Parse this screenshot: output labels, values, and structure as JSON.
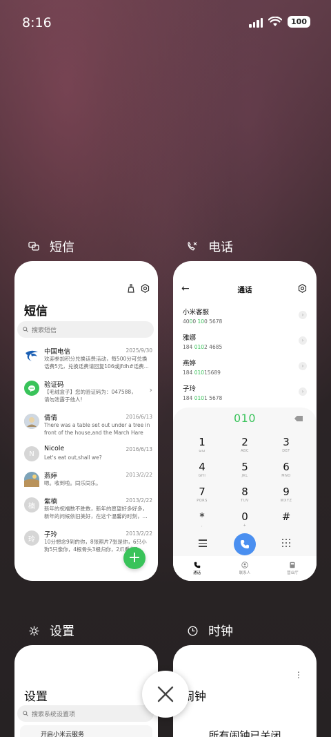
{
  "status_bar": {
    "time": "8:16",
    "battery": "100"
  },
  "apps": {
    "sms": {
      "label": "短信",
      "title": "短信",
      "search_placeholder": "搜索短信",
      "conversations": [
        {
          "name": "中国电信",
          "date": "2025/9/30",
          "preview": "欢迎参加积分兑换话费活动，每500分可兑换\n话费5元，兑换话费请回复106或jfdh#话费...",
          "avatar_color": "#1a5fb4"
        },
        {
          "name": "验证码",
          "date": "",
          "preview": "【毛绒盒子】您的验证码为：047588，\n请勿泄露于他人!",
          "avatar_color": "#39c35a"
        },
        {
          "name": "倩倩",
          "date": "2016/6/13",
          "preview": "There was a table set out under a tree in\nfront of the house,and the March Hare an...",
          "avatar_color": "#c9b48a"
        },
        {
          "name": "Nicole",
          "date": "2016/6/13",
          "preview": "Let's eat out,shall we?",
          "avatar_initial": "N",
          "avatar_color": "#d6d6d6"
        },
        {
          "name": "燕婷",
          "date": "2013/2/22",
          "preview": "嗯。收到啦。同乐同乐。",
          "avatar_color": "#6a8aa0"
        },
        {
          "name": "紫楠",
          "date": "2013/2/22",
          "preview": "新年的祝福数不胜数，新年的愿望好多好多，\n新年的问候依旧美好，在这个温馨的时刻，...",
          "avatar_initial": "楠",
          "avatar_color": "#d6d6d6"
        },
        {
          "name": "子玲",
          "date": "2013/2/22",
          "preview": "10分想念9到的你，8张照片7张是你，6只小\n狗5只像你，4根骨头3根归你，2爪看你1...",
          "avatar_initial": "玲",
          "avatar_color": "#d6d6d6"
        }
      ],
      "fab_label": "+"
    },
    "phone": {
      "label": "电话",
      "title": "通话",
      "contacts": [
        {
          "name": "小米客服",
          "num_pre": "40",
          "num_hl": "0",
          "num_mid": "0 ",
          "num_hl2": "10",
          "num_post": "0 5678"
        },
        {
          "name": "雅娜",
          "num_pre": "184 ",
          "num_hl": "010",
          "num_mid": "2 4685",
          "num_hl2": "",
          "num_post": ""
        },
        {
          "name": "燕婷",
          "num_pre": "184 ",
          "num_hl": "010",
          "num_mid": "15689",
          "num_hl2": "",
          "num_post": ""
        },
        {
          "name": "子玲",
          "num_pre": "184 ",
          "num_hl": "010",
          "num_mid": "1 5678",
          "num_hl2": "",
          "num_post": ""
        }
      ],
      "dialed": "010",
      "keys": [
        {
          "d": "1",
          "l": "ωω"
        },
        {
          "d": "2",
          "l": "ABC"
        },
        {
          "d": "3",
          "l": "DEF"
        },
        {
          "d": "4",
          "l": "GHI"
        },
        {
          "d": "5",
          "l": "JKL"
        },
        {
          "d": "6",
          "l": "MNO"
        },
        {
          "d": "7",
          "l": "PQRS"
        },
        {
          "d": "8",
          "l": "TUV"
        },
        {
          "d": "9",
          "l": "WXYZ"
        },
        {
          "d": "*",
          "l": ","
        },
        {
          "d": "0",
          "l": "+"
        },
        {
          "d": "#",
          "l": ""
        }
      ],
      "tabs": [
        "通话",
        "联系人",
        "营业厅"
      ]
    },
    "settings": {
      "label": "设置",
      "title": "设置",
      "search_placeholder": "搜索系统设置项",
      "first_row": "开启小米云服务"
    },
    "clock": {
      "label": "时钟",
      "title": "闹钟",
      "status": "所有闹钟已关闭"
    }
  },
  "colors": {
    "accent_green": "#39c35a",
    "call_blue": "#4a8ff0"
  }
}
